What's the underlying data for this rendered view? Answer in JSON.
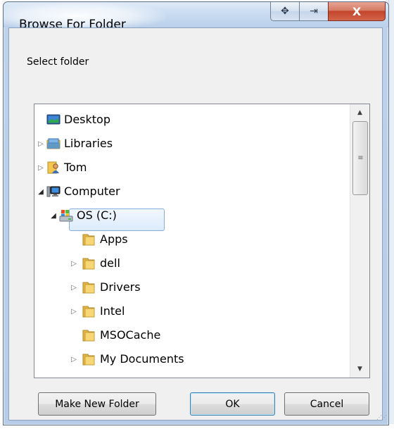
{
  "window": {
    "title": "Browse For Folder",
    "buttons": {
      "move_glyph": "✥",
      "restore_glyph": "⇥",
      "close_glyph": "X"
    }
  },
  "prompt": "Select folder",
  "tree": {
    "items": [
      {
        "label": "Desktop",
        "icon": "desktop-icon",
        "expander": ""
      },
      {
        "label": "Libraries",
        "icon": "libraries-icon",
        "expander": "▷"
      },
      {
        "label": "Tom",
        "icon": "user-folder-icon",
        "expander": "▷"
      },
      {
        "label": "Computer",
        "icon": "computer-icon",
        "expander": "◢"
      },
      {
        "label": "OS (C:)",
        "icon": "drive-icon",
        "expander": "◢",
        "selected": true
      },
      {
        "label": "Apps",
        "icon": "folder-icon",
        "expander": ""
      },
      {
        "label": "dell",
        "icon": "folder-icon",
        "expander": "▷"
      },
      {
        "label": "Drivers",
        "icon": "folder-icon",
        "expander": "▷"
      },
      {
        "label": "Intel",
        "icon": "folder-icon",
        "expander": "▷"
      },
      {
        "label": "MSOCache",
        "icon": "folder-icon",
        "expander": ""
      },
      {
        "label": "My Documents",
        "icon": "folder-icon",
        "expander": "▷"
      }
    ]
  },
  "scrollbar": {
    "up_glyph": "▲",
    "down_glyph": "▼",
    "grip_glyph": "≡"
  },
  "buttons": {
    "make_new_folder": "Make New Folder",
    "ok": "OK",
    "cancel": "Cancel"
  },
  "colors": {
    "title_bar": "#c9dcf1",
    "close_button": "#c4452b",
    "selection_border": "#84acdd",
    "folder_yellow": "#f3c74f"
  }
}
